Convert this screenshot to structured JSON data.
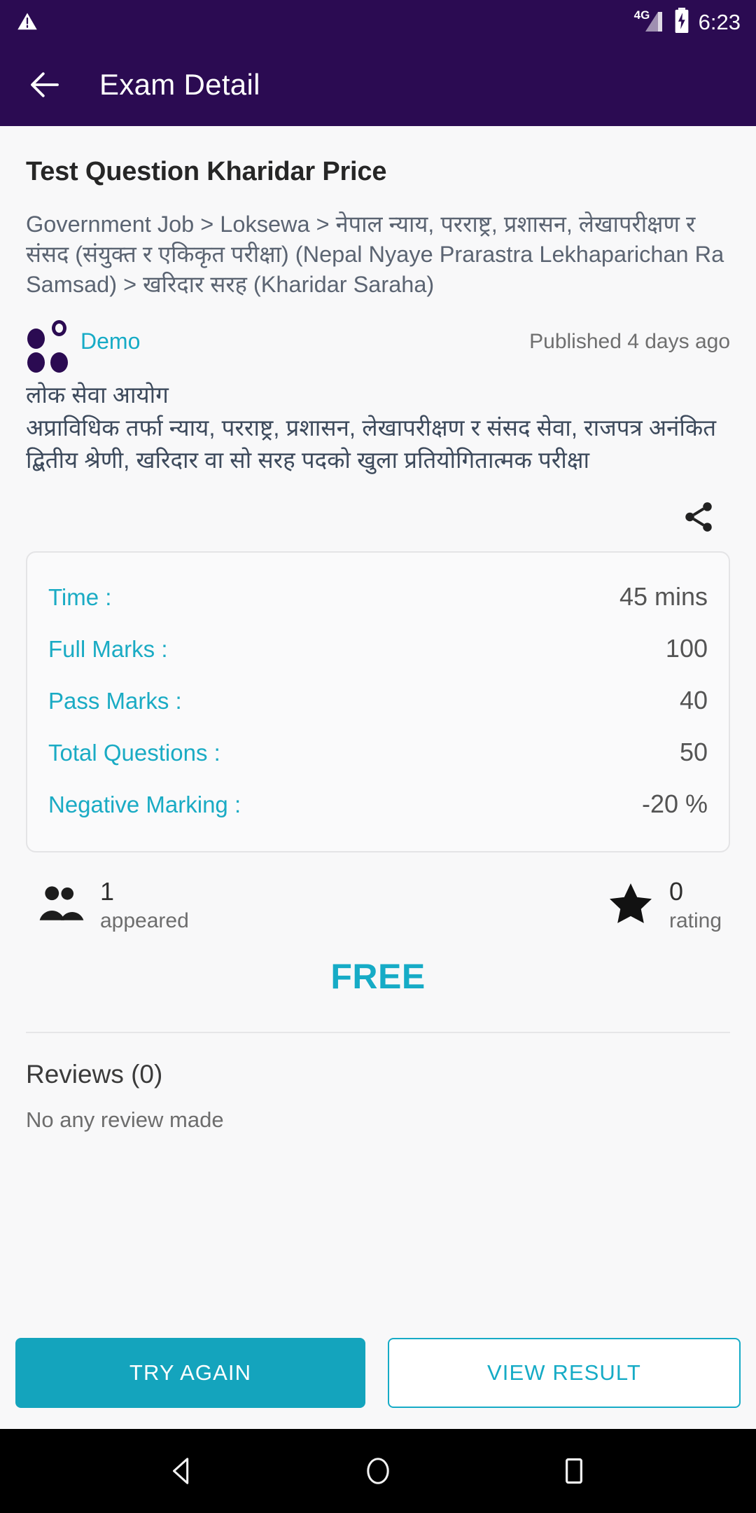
{
  "statusbar": {
    "warning_icon": "warning-triangle-icon",
    "network_label": "4G",
    "signal_icon": "signal-bars-icon",
    "battery_icon": "battery-charging-icon",
    "time": "6:23"
  },
  "appbar": {
    "back_icon": "arrow-left-icon",
    "title": "Exam Detail"
  },
  "exam": {
    "title": "Test Question Kharidar Price",
    "breadcrumb": "Government Job > Loksewa > नेपाल न्याय, परराष्ट्र, प्रशासन, लेखापरीक्षण र संसद (संयुक्त र एकिकृत परीक्षा) (Nepal Nyaye Prarastra Lekhaparichan Ra Samsad) > खरिदार  सरह (Kharidar Saraha)",
    "publisher": "Demo",
    "published": "Published 4 days ago",
    "description": "लोक सेवा आयोग\nअप्राविधिक तर्फा न्याय, परराष्ट्र, प्रशासन, लेखापरीक्षण र संसद सेवा, राजपत्र अनंकित द्बितीय श्रेणी, खरिदार वा सो सरह पदको खुला प्रतियोगितात्मक परीक्षा",
    "share_icon": "share-icon"
  },
  "info_card": {
    "rows": [
      {
        "label": "Time :",
        "value": "45 mins"
      },
      {
        "label": "Full Marks :",
        "value": "100"
      },
      {
        "label": "Pass Marks :",
        "value": "40"
      },
      {
        "label": "Total Questions :",
        "value": "50"
      },
      {
        "label": "Negative Marking :",
        "value": "-20 %"
      }
    ]
  },
  "stats": {
    "appeared": {
      "icon": "people-icon",
      "count": "1",
      "caption": "appeared"
    },
    "rating": {
      "icon": "star-icon",
      "count": "0",
      "caption": "rating"
    }
  },
  "price": "FREE",
  "reviews": {
    "title": "Reviews (0)",
    "empty": "No any review made"
  },
  "actions": {
    "primary": "TRY AGAIN",
    "secondary": "VIEW RESULT"
  },
  "navbar": {
    "back": "nav-back-icon",
    "home": "nav-home-icon",
    "recents": "nav-recents-icon"
  },
  "colors": {
    "appbar": "#2b0b52",
    "accent": "#16abc6",
    "primary_button": "#14a4bd",
    "page_bg": "#f8f8f9",
    "breadcrumb_text": "#5b6472"
  }
}
